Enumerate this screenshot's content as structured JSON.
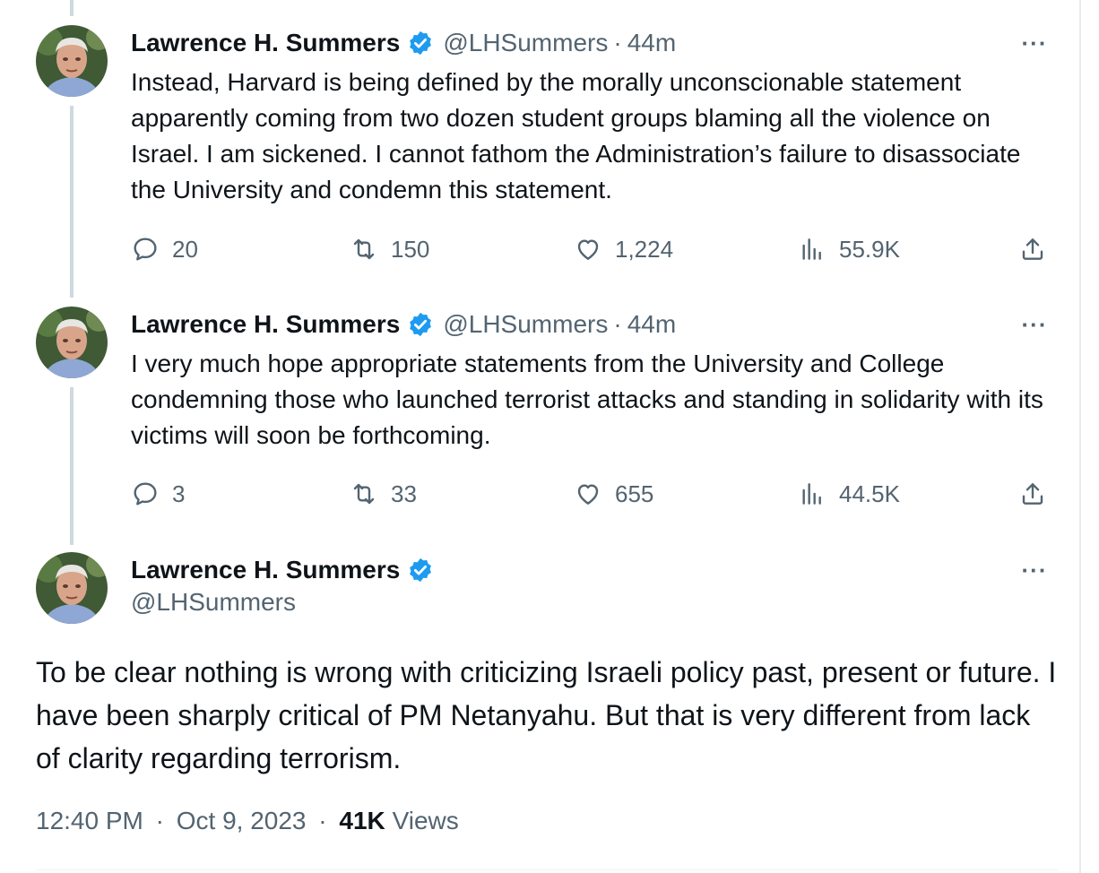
{
  "author": {
    "name": "Lawrence H. Summers",
    "handle": "@LHSummers",
    "verified_color": "#1d9bf0"
  },
  "tweets": [
    {
      "time": "44m",
      "text": "Instead, Harvard is being defined by the morally unconscionable statement apparently coming from two dozen student groups blaming all the violence on Israel. I am sickened. I cannot fathom the Administration’s failure to disassociate the University and condemn this statement.",
      "replies": "20",
      "reposts": "150",
      "likes": "1,224",
      "views": "55.9K"
    },
    {
      "time": "44m",
      "text": "I very much hope appropriate statements from the University and College condemning those who launched terrorist attacks and standing in solidarity with its victims will soon be forthcoming.",
      "replies": "3",
      "reposts": "33",
      "likes": "655",
      "views": "44.5K"
    }
  ],
  "main_tweet": {
    "text": "To be clear nothing is wrong with criticizing Israeli policy past, present or future.  I have been sharply critical of PM Netanyahu. But that is very different from lack of clarity regarding terrorism.",
    "time": "12:40 PM",
    "date": "Oct 9, 2023",
    "views_count": "41K",
    "views_label": "Views"
  },
  "separator": "·",
  "more_label": "···",
  "icons": {
    "reply": "reply-icon",
    "repost": "repost-icon",
    "like": "heart-icon",
    "views": "views-icon",
    "share": "share-icon",
    "more": "more-icon",
    "verified": "verified-badge-icon"
  }
}
